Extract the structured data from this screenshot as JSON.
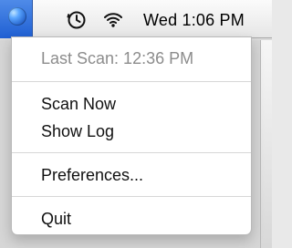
{
  "menu_bar": {
    "clock": "Wed 1:06 PM",
    "icons": {
      "app": "globe-icon",
      "time_machine": "time-machine-icon",
      "wifi": "wifi-icon"
    }
  },
  "dropdown": {
    "last_scan": "Last Scan: 12:36 PM",
    "scan_now": "Scan Now",
    "show_log": "Show Log",
    "preferences": "Preferences...",
    "quit": "Quit"
  },
  "colors": {
    "accent": "#2f6fd5",
    "disabled_text": "#8c8c8c"
  }
}
